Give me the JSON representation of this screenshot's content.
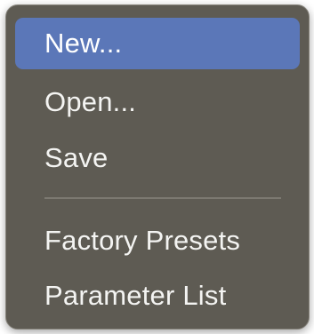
{
  "menu": {
    "items": [
      {
        "label": "New...",
        "selected": true
      },
      {
        "label": "Open...",
        "selected": false
      },
      {
        "label": "Save",
        "selected": false
      }
    ],
    "items_after_separator": [
      {
        "label": "Factory Presets",
        "selected": false
      },
      {
        "label": "Parameter List",
        "selected": false
      }
    ]
  },
  "colors": {
    "menu_background": "#5e5b53",
    "highlight": "#5b77b8",
    "text": "#f4f4f2",
    "separator": "#7c7971"
  }
}
